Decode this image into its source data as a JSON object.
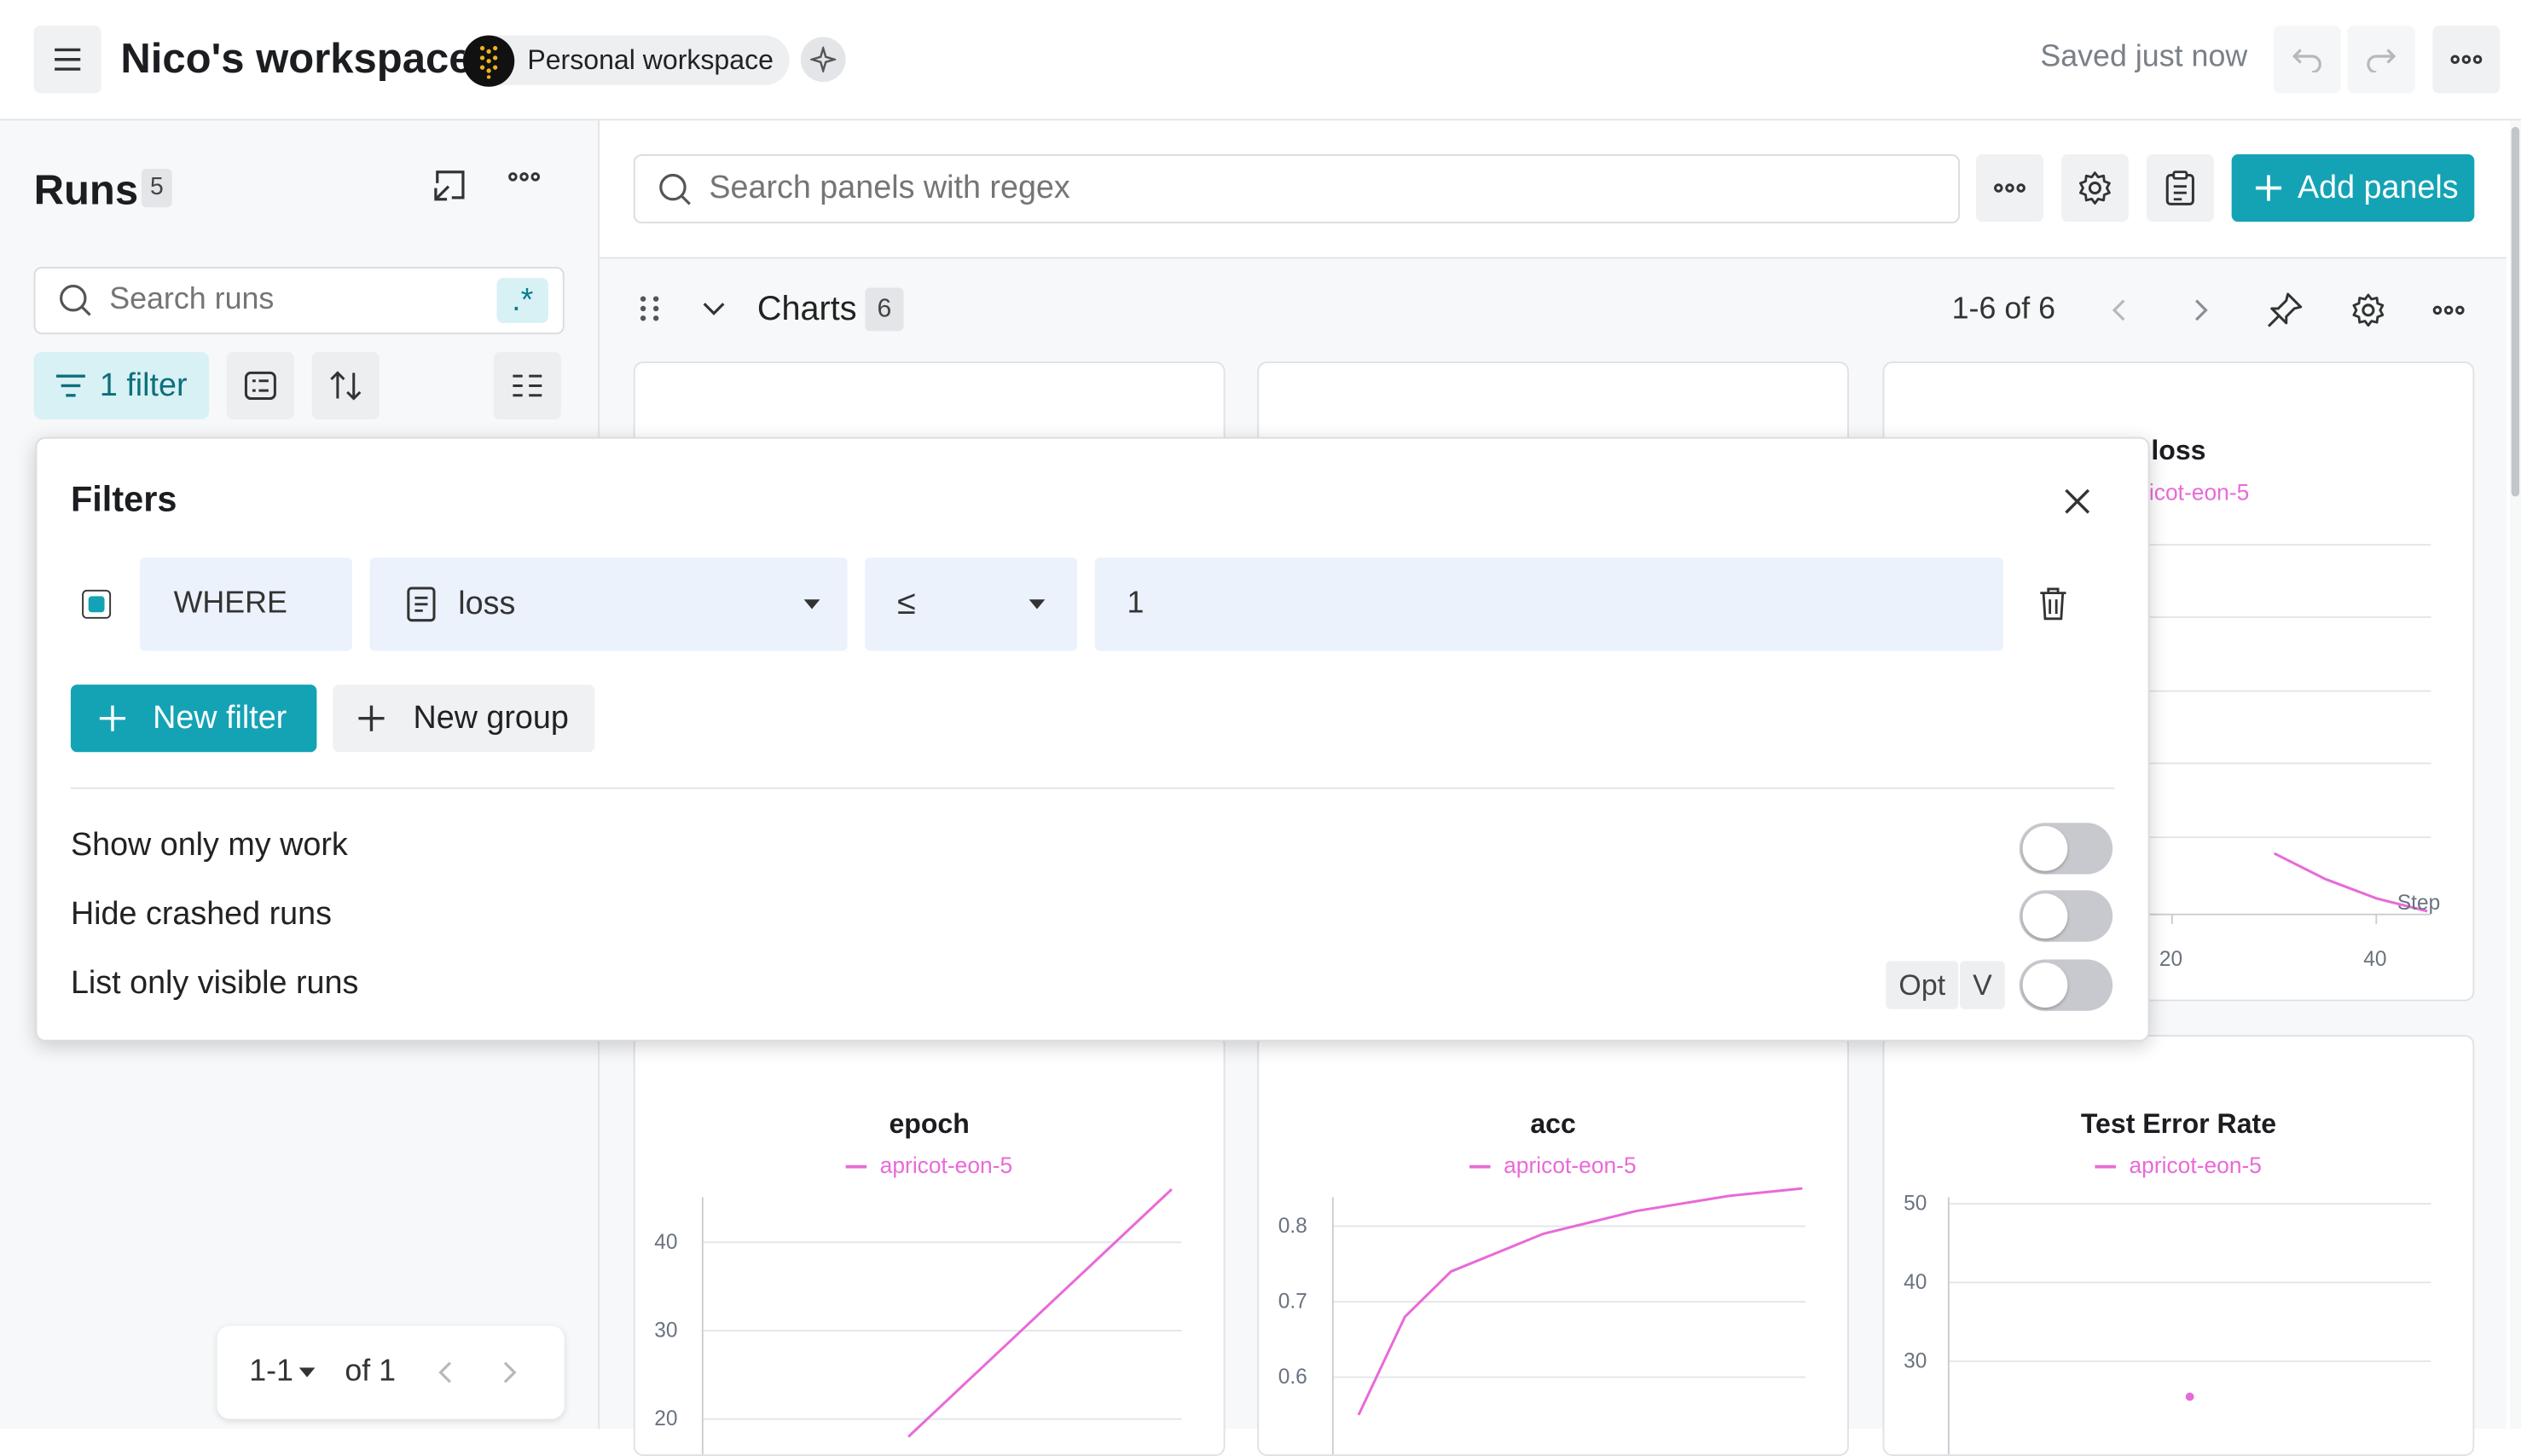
{
  "header": {
    "title": "Nico's workspace",
    "workspace_badge": "Personal workspace",
    "saved_status": "Saved just now"
  },
  "runs_sidebar": {
    "title": "Runs",
    "count": "5",
    "search_placeholder": "Search runs",
    "regex_label": ".*",
    "filter_label": "1 filter",
    "pagination": {
      "range": "1-1",
      "of": "of 1"
    }
  },
  "panels_toolbar": {
    "search_placeholder": "Search panels with regex",
    "add_panels_label": "Add panels"
  },
  "section": {
    "title": "Charts",
    "count": "6",
    "range": "1-6 of 6"
  },
  "filters_popover": {
    "title": "Filters",
    "rule": {
      "where": "WHERE",
      "field": "loss",
      "operator": "≤",
      "value": "1"
    },
    "new_filter_label": "New filter",
    "new_group_label": "New group",
    "toggles": [
      {
        "label": "Show only my work",
        "on": false
      },
      {
        "label": "Hide crashed runs",
        "on": false
      },
      {
        "label": "List only visible runs",
        "on": false,
        "shortcut": [
          "Opt",
          "V"
        ]
      }
    ]
  },
  "colors": {
    "accent": "#13a3b5",
    "series": "#e86ad8"
  },
  "panels": {
    "loss": {
      "title": "loss",
      "legend": "ricot-eon-5",
      "x_axis_title": "Step",
      "x_ticks": [
        "20",
        "40"
      ]
    },
    "epoch": {
      "title": "epoch",
      "legend": "apricot-eon-5",
      "y_ticks": [
        "40",
        "30",
        "20"
      ]
    },
    "acc": {
      "title": "acc",
      "legend": "apricot-eon-5",
      "y_ticks": [
        "0.8",
        "0.7",
        "0.6"
      ]
    },
    "test_error": {
      "title": "Test Error Rate",
      "legend": "apricot-eon-5",
      "y_ticks": [
        "50",
        "40",
        "30"
      ]
    }
  },
  "chart_data": [
    {
      "type": "line",
      "title": "loss",
      "series": [
        {
          "name": "apricot-eon-5",
          "x": [
            30,
            35,
            40,
            45
          ],
          "y": [
            0.3,
            0.26,
            0.23,
            0.21
          ]
        }
      ],
      "xlabel": "Step"
    },
    {
      "type": "line",
      "title": "epoch",
      "series": [
        {
          "name": "apricot-eon-5",
          "x": [
            20,
            30,
            40,
            48
          ],
          "y": [
            18,
            28,
            38,
            46
          ]
        }
      ],
      "ylim": [
        17,
        47
      ]
    },
    {
      "type": "line",
      "title": "acc",
      "series": [
        {
          "name": "apricot-eon-5",
          "x": [
            0,
            5,
            10,
            20,
            30,
            40,
            48
          ],
          "y": [
            0.55,
            0.68,
            0.74,
            0.79,
            0.82,
            0.84,
            0.85
          ]
        }
      ],
      "ylim": [
        0.55,
        0.87
      ]
    },
    {
      "type": "scatter",
      "title": "Test Error Rate",
      "series": [
        {
          "name": "apricot-eon-5",
          "x": [
            25
          ],
          "y": [
            25.5
          ]
        }
      ],
      "ylim": [
        22,
        52
      ]
    }
  ]
}
